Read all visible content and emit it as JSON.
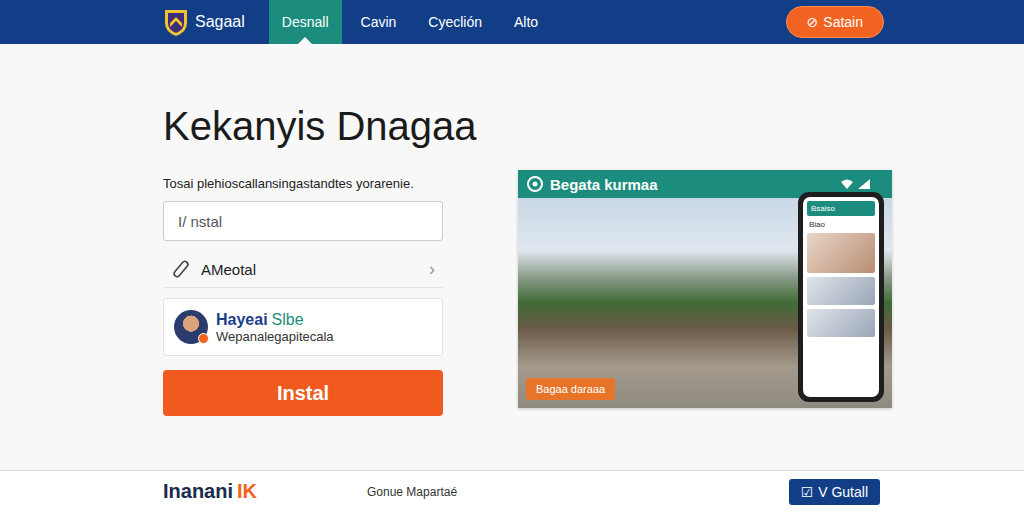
{
  "brand": {
    "name": "Sagaal"
  },
  "nav": [
    {
      "label": "Desnall",
      "selected": true
    },
    {
      "label": "Cavin",
      "selected": false
    },
    {
      "label": "Cyeclión",
      "selected": false
    },
    {
      "label": "Alto",
      "selected": false
    }
  ],
  "header_button": {
    "icon": "⊘",
    "label": "Satain"
  },
  "hero": {
    "title": "Kekanyis Dnagaa",
    "subtitle": "Tosai plehioscallansingastandtes yorarenie."
  },
  "search": {
    "placeholder": "I/ nstal"
  },
  "link_row": {
    "label": "AMeotal",
    "chevron": "›"
  },
  "profile": {
    "name_first": "Hayeai",
    "name_second": "Slbe",
    "detail": "Wepanalegapitecala"
  },
  "install_button": "Instal",
  "preview": {
    "title": "Begata kurmaa",
    "badge": "Bagaa daraaa",
    "phone": {
      "header": "Bsaiso",
      "lines": [
        "Biao"
      ]
    }
  },
  "footer": {
    "brand": "Inanani",
    "brand_accent": "IK",
    "text": "Gonue Mapartaé",
    "button": {
      "icon": "☑",
      "label": "V Gutall"
    }
  }
}
